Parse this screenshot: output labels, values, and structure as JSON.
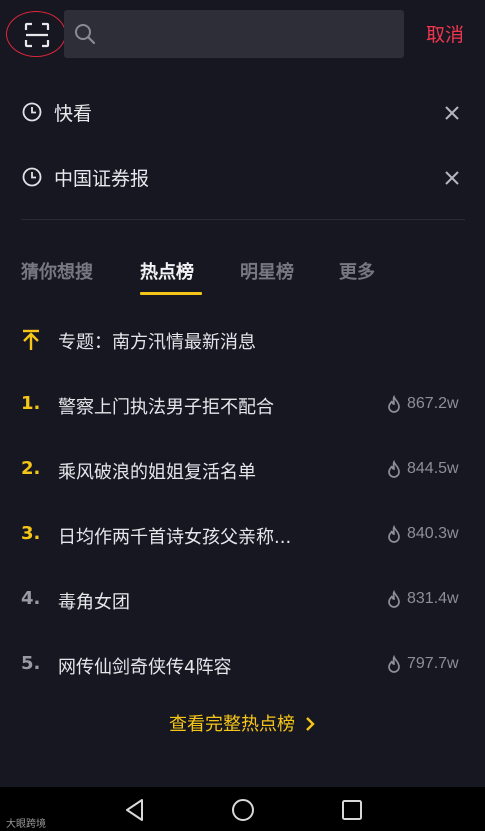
{
  "search": {
    "placeholder": "",
    "cancel_label": "取消"
  },
  "history": [
    {
      "text": "快看"
    },
    {
      "text": "中国证券报"
    }
  ],
  "tabs": [
    {
      "label": "猜你想搜",
      "active": false
    },
    {
      "label": "热点榜",
      "active": true
    },
    {
      "label": "明星榜",
      "active": false
    },
    {
      "label": "更多",
      "active": false
    }
  ],
  "pinned": {
    "text": "专题：南方汛情最新消息"
  },
  "rankings": [
    {
      "rank": "1.",
      "title": "警察上门执法男子拒不配合",
      "heat": "867.2w"
    },
    {
      "rank": "2.",
      "title": "乘风破浪的姐姐复活名单",
      "heat": "844.5w"
    },
    {
      "rank": "3.",
      "title": "日均作两千首诗女孩父亲称...",
      "heat": "840.3w"
    },
    {
      "rank": "4.",
      "title": "毒角女团",
      "heat": "831.4w"
    },
    {
      "rank": "5.",
      "title": "网传仙剑奇侠传4阵容",
      "heat": "797.7w"
    }
  ],
  "full_list_label": "查看完整热点榜",
  "watermark": "大眼跨境",
  "colors": {
    "background": "#171722",
    "accent_yellow": "#f5c518",
    "cancel_red": "#f0364f",
    "muted": "#77777f"
  },
  "icons": {
    "scan": "scan-icon",
    "search": "search-icon",
    "history": "clock-icon",
    "delete": "close-icon",
    "pinned": "pin-top-icon",
    "heat": "flame-icon",
    "more": "chevron-right-icon",
    "nav_back": "back-triangle-icon",
    "nav_home": "home-circle-icon",
    "nav_recent": "recent-square-icon"
  }
}
